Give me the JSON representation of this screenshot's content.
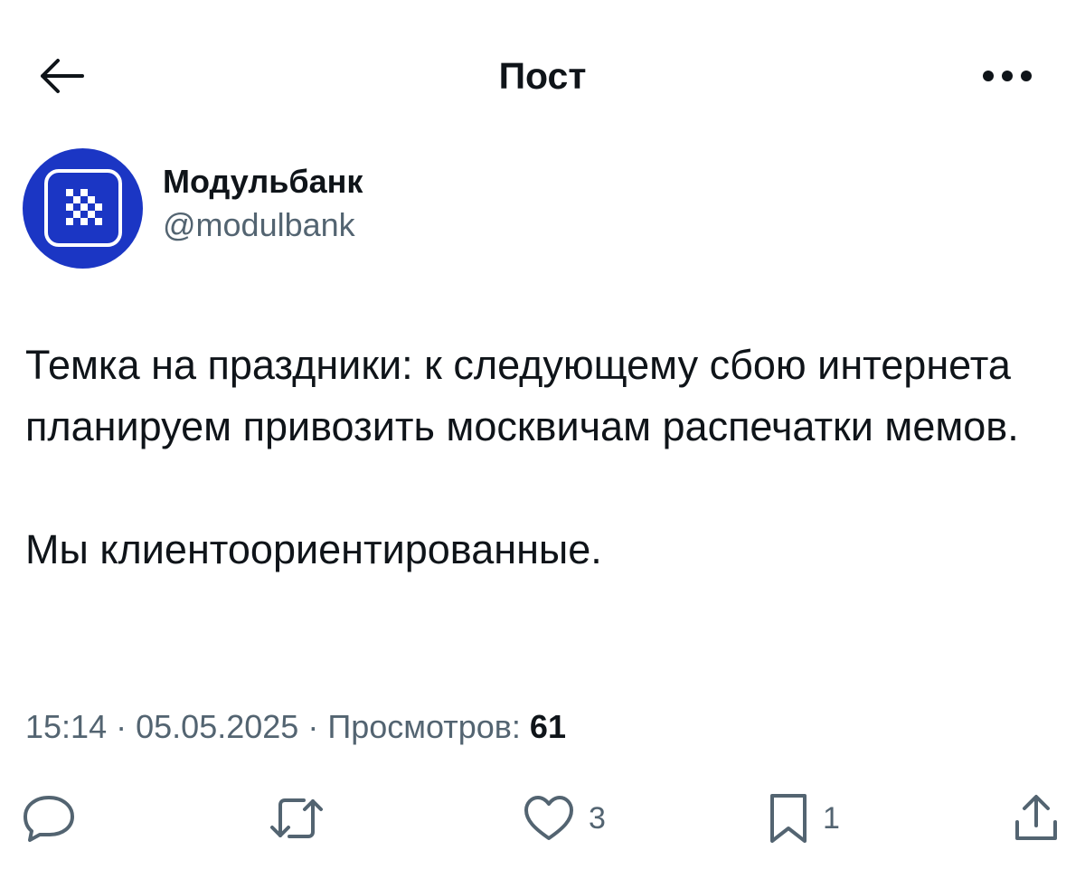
{
  "header": {
    "title": "Пост",
    "back_icon": "arrow-left-icon",
    "more_icon": "more-horizontal-icon"
  },
  "author": {
    "name": "Модульбанк",
    "handle": "@modulbank",
    "avatar_color": "#1b36c4"
  },
  "post": {
    "paragraphs": [
      "Темка на праздники: к следующему сбою интернета планируем привозить москвичам распечатки мемов.",
      "Мы клиентоориентированные."
    ]
  },
  "meta": {
    "time": "15:14",
    "date": "05.05.2025",
    "separator": "·",
    "views_label": "Просмотров:",
    "views_count": "61"
  },
  "actions": {
    "reply": {
      "icon": "reply-icon",
      "count": ""
    },
    "repost": {
      "icon": "repost-icon",
      "count": ""
    },
    "like": {
      "icon": "heart-icon",
      "count": "3"
    },
    "bookmark": {
      "icon": "bookmark-icon",
      "count": "1"
    },
    "share": {
      "icon": "share-icon",
      "count": ""
    }
  },
  "colors": {
    "text_primary": "#0f1419",
    "text_secondary": "#536471",
    "brand_blue": "#1b36c4"
  }
}
